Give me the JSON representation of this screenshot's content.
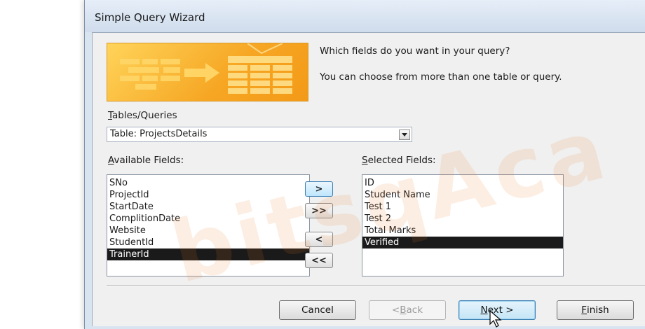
{
  "window": {
    "title": "Simple Query Wizard"
  },
  "prompt": {
    "question": "Which fields do you want in your query?",
    "hint": "You can choose from more than one table or query."
  },
  "tables_queries": {
    "label_u": "T",
    "label_rest": "ables/Queries",
    "selected": "Table: ProjectsDetails"
  },
  "available_fields": {
    "label_u": "A",
    "label_rest": "vailable Fields:",
    "items": [
      "SNo",
      "ProjectId",
      "StartDate",
      "ComplitionDate",
      "Website",
      "StudentId",
      "TrainerId"
    ],
    "selected_index": 6
  },
  "selected_fields": {
    "label_u": "S",
    "label_rest": "elected Fields:",
    "items": [
      "ID",
      "Student Name",
      "Test 1",
      "Test 2",
      "Total Marks",
      "Verified"
    ],
    "selected_index": 5
  },
  "move_buttons": {
    "add_one": ">",
    "add_all": ">>",
    "remove_one": "<",
    "remove_all": "<<"
  },
  "buttons": {
    "cancel": "Cancel",
    "back_u": "B",
    "back_pre": "< ",
    "back_rest": "ack",
    "next_u": "N",
    "next_rest": "ext >",
    "finish_u": "F",
    "finish_rest": "inish"
  },
  "colors": {
    "banner": "#f6a623",
    "selection": "#1a1a1a",
    "default_button": "#c4e5f6"
  }
}
